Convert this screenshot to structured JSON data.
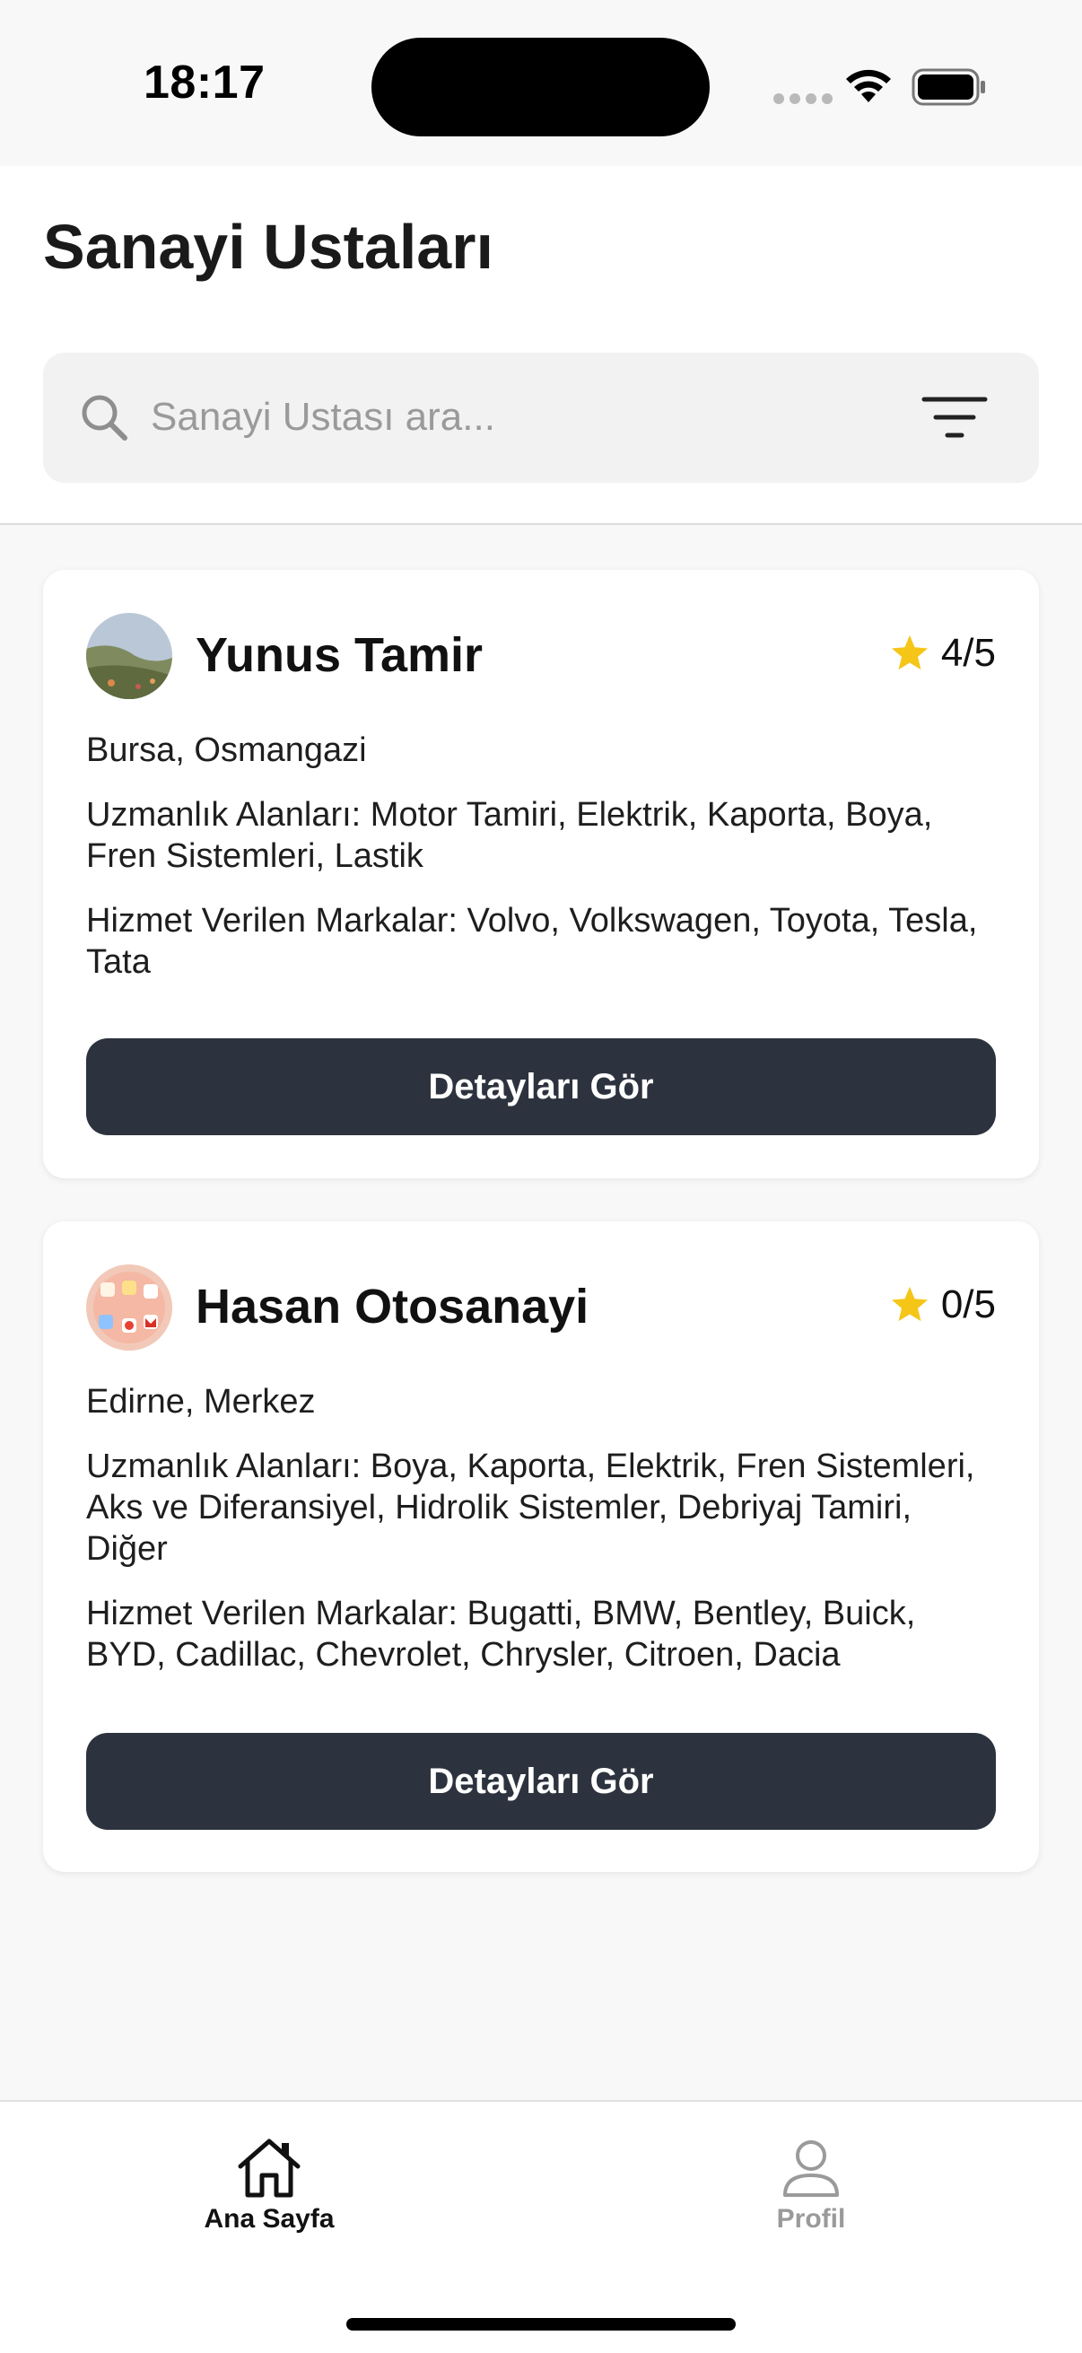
{
  "status_bar": {
    "time": "18:17"
  },
  "header": {
    "title": "Sanayi Ustaları",
    "search": {
      "placeholder": "Sanayi Ustası ara...",
      "value": ""
    }
  },
  "mechanics": [
    {
      "name": "Yunus Tamir",
      "rating": "4/5",
      "location": "Bursa, Osmangazi",
      "specialties": "Uzmanlık Alanları: Motor Tamiri, Elektrik, Kaporta, Boya, Fren Sistemleri, Lastik",
      "brands": "Hizmet Verilen Markalar: Volvo, Volkswagen, Toyota, Tesla, Tata",
      "button_label": "Detayları Gör"
    },
    {
      "name": "Hasan Otosanayi",
      "rating": "0/5",
      "location": "Edirne, Merkez",
      "specialties": "Uzmanlık Alanları: Boya, Kaporta, Elektrik, Fren Sistemleri, Aks ve Diferansiyel, Hidrolik Sistemler, Debriyaj Tamiri, Diğer",
      "brands": "Hizmet Verilen Markalar: Bugatti, BMW, Bentley, Buick, BYD, Cadillac, Chevrolet, Chrysler, Citroen, Dacia",
      "button_label": "Detayları Gör"
    }
  ],
  "tab_bar": {
    "tabs": [
      {
        "label": "Ana Sayfa",
        "icon": "home-icon",
        "active": true
      },
      {
        "label": "Profil",
        "icon": "profile-icon",
        "active": false
      }
    ]
  },
  "colors": {
    "button_bg": "#2d333e",
    "star": "#f5c518",
    "inactive_tab": "#9a9a9a"
  }
}
